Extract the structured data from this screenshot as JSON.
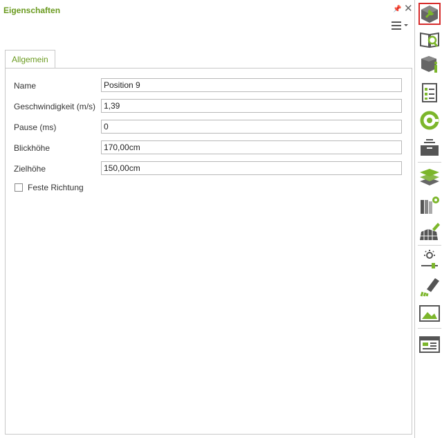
{
  "panel": {
    "title": "Eigenschaften"
  },
  "tabs": [
    {
      "label": "Allgemein"
    }
  ],
  "fields": [
    {
      "label": "Name",
      "value": "Position 9"
    },
    {
      "label": "Geschwindigkeit (m/s)",
      "value": "1,39"
    },
    {
      "label": "Pause (ms)",
      "value": "0"
    },
    {
      "label": "Blickhöhe",
      "value": "170,00cm"
    },
    {
      "label": "Zielhöhe",
      "value": "150,00cm"
    }
  ],
  "checkbox": {
    "label": "Feste Richtung",
    "checked": false
  },
  "sidebar_icons": [
    "properties-wrench-cube-icon",
    "book-search-icon",
    "box-info-icon",
    "checklist-icon",
    "refresh-icon",
    "archive-icon",
    "layers-icon",
    "materials-gear-icon",
    "grid-pencil-icon",
    "light-slider-icon",
    "pen-nib-icon",
    "image-icon",
    "layout-icon"
  ],
  "colors": {
    "accent": "#6a9a1f",
    "icon_dark": "#555555",
    "icon_green": "#7cb62b",
    "selected_border": "#d62b2b"
  }
}
